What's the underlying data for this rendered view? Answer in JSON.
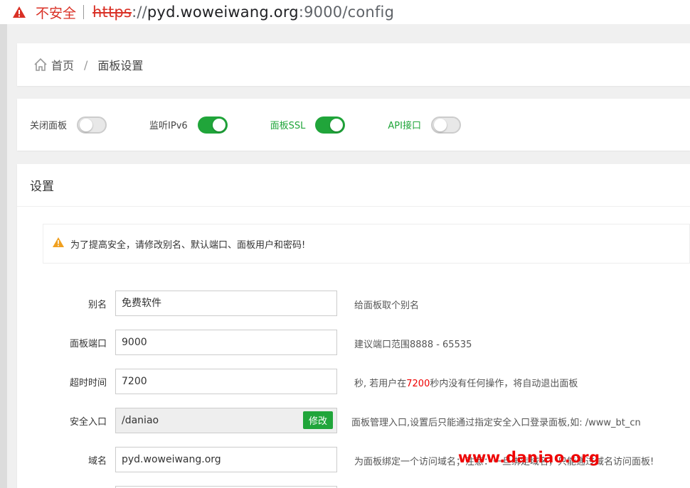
{
  "browser": {
    "insecure_label": "不安全",
    "url_scheme": "https",
    "url_sep": "://",
    "url_host": "pyd.woweiwang.org",
    "url_port": ":9000",
    "url_path": "/config"
  },
  "breadcrumb": {
    "home_label": "首页",
    "separator": "/",
    "current_label": "面板设置"
  },
  "toggles": [
    {
      "label": "关闭面板",
      "on": false,
      "green_label": false
    },
    {
      "label": "监听IPv6",
      "on": true,
      "green_label": false
    },
    {
      "label": "面板SSL",
      "on": true,
      "green_label": true
    },
    {
      "label": "API接口",
      "on": false,
      "green_label": true
    }
  ],
  "settings": {
    "title": "设置",
    "notice": "为了提高安全，请修改别名、默认端口、面板用户和密码!",
    "rows": [
      {
        "key": "别名",
        "value": "免费软件",
        "hint": "给面板取个别名"
      },
      {
        "key": "面板端口",
        "value": "9000",
        "hint": "建议端口范围8888 - 65535"
      },
      {
        "key": "超时时间",
        "value": "7200",
        "hint_pre": "秒, 若用户在",
        "hint_red": "7200",
        "hint_post": "秒内没有任何操作，将自动退出面板"
      },
      {
        "key": "安全入口",
        "value": "/daniao",
        "button": "修改",
        "hint": "面板管理入口,设置后只能通过指定安全入口登录面板,如: /www_bt_cn"
      },
      {
        "key": "域名",
        "value": "pyd.woweiwang.org",
        "hint": "为面板绑定一个访问域名；注意：一旦绑定域名，只能通过域名访问面板!"
      }
    ]
  },
  "watermark": "www.daniao.org",
  "colors": {
    "green": "#20a53a",
    "red": "#e00000",
    "warning": "#f0a020"
  }
}
